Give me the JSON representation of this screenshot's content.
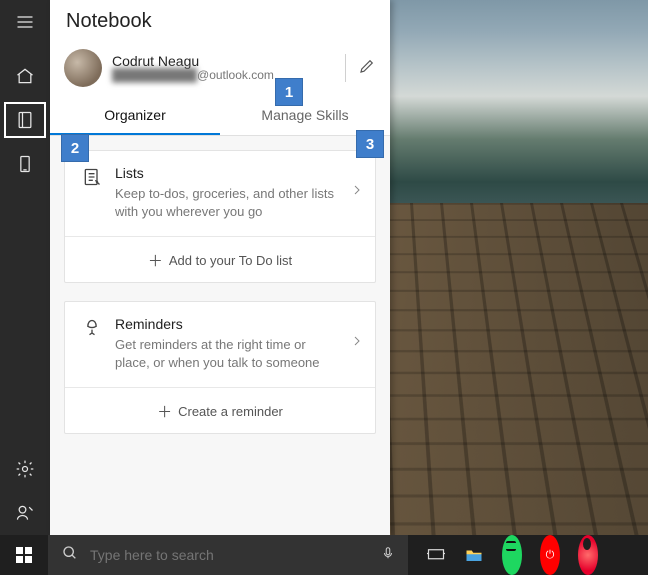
{
  "panel": {
    "title": "Notebook",
    "profile": {
      "name": "Codrut Neagu",
      "email_local": "██████████",
      "email_domain": "@outlook.com"
    },
    "tabs": {
      "organizer": "Organizer",
      "manage_skills": "Manage Skills"
    },
    "cards": {
      "lists": {
        "title": "Lists",
        "desc": "Keep to-dos, groceries, and other lists with you wherever you go",
        "action": "Add to your To Do list"
      },
      "reminders": {
        "title": "Reminders",
        "desc": "Get reminders at the right time or place, or when you talk to someone",
        "action": "Create a reminder"
      }
    }
  },
  "callouts": {
    "one": "1",
    "two": "2",
    "three": "3"
  },
  "taskbar": {
    "search_placeholder": "Type here to search"
  }
}
